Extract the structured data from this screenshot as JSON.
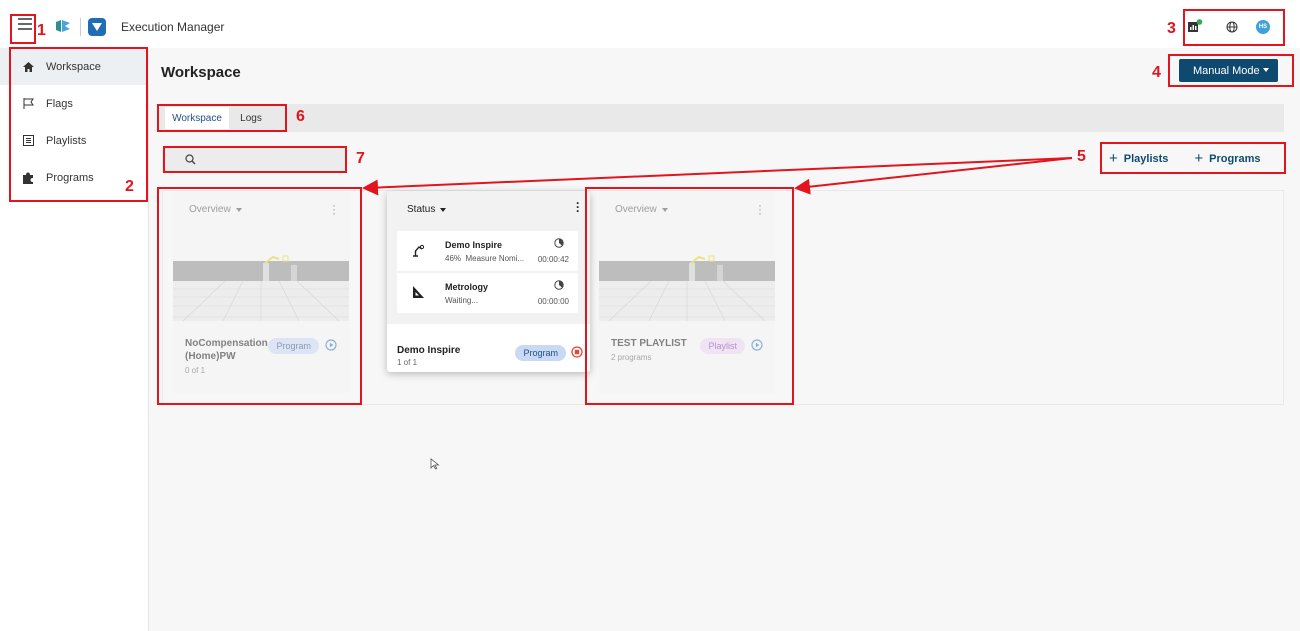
{
  "app": {
    "title": "Execution Manager",
    "user_initials": "HS"
  },
  "sidebar": {
    "items": [
      {
        "label": "Workspace",
        "icon": "home-icon",
        "active": true
      },
      {
        "label": "Flags",
        "icon": "flag-icon"
      },
      {
        "label": "Playlists",
        "icon": "list-icon"
      },
      {
        "label": "Programs",
        "icon": "puzzle-icon"
      }
    ]
  },
  "main": {
    "title": "Workspace",
    "mode_button": "Manual Mode",
    "tabs": [
      {
        "label": "Workspace",
        "active": true
      },
      {
        "label": "Logs"
      }
    ],
    "search_placeholder": "",
    "add_playlists": "Playlists",
    "add_programs": "Programs"
  },
  "cards": [
    {
      "header": "Overview",
      "name": "NoCompensation (Home)PW",
      "sub": "0 of 1",
      "badge": "Program"
    },
    {
      "header": "Status",
      "name": "Demo Inspire",
      "sub": "1 of 1",
      "badge": "Program"
    },
    {
      "header": "Overview",
      "name": "TEST PLAYLIST",
      "sub": "2 programs",
      "badge": "Playlist"
    }
  ],
  "status_items": [
    {
      "name": "Demo Inspire",
      "progress_label": "46%",
      "step": "Measure Nomi...",
      "time": "00:00:42",
      "progress_value": 0.46
    },
    {
      "name": "Metrology",
      "step": "Waiting...",
      "time": "00:00:00"
    }
  ],
  "annotations": [
    "1",
    "2",
    "3",
    "4",
    "5",
    "6",
    "7"
  ],
  "colors": {
    "accent": "#0e4a70",
    "annotation": "#e2141d",
    "online": "#2fa84f"
  }
}
